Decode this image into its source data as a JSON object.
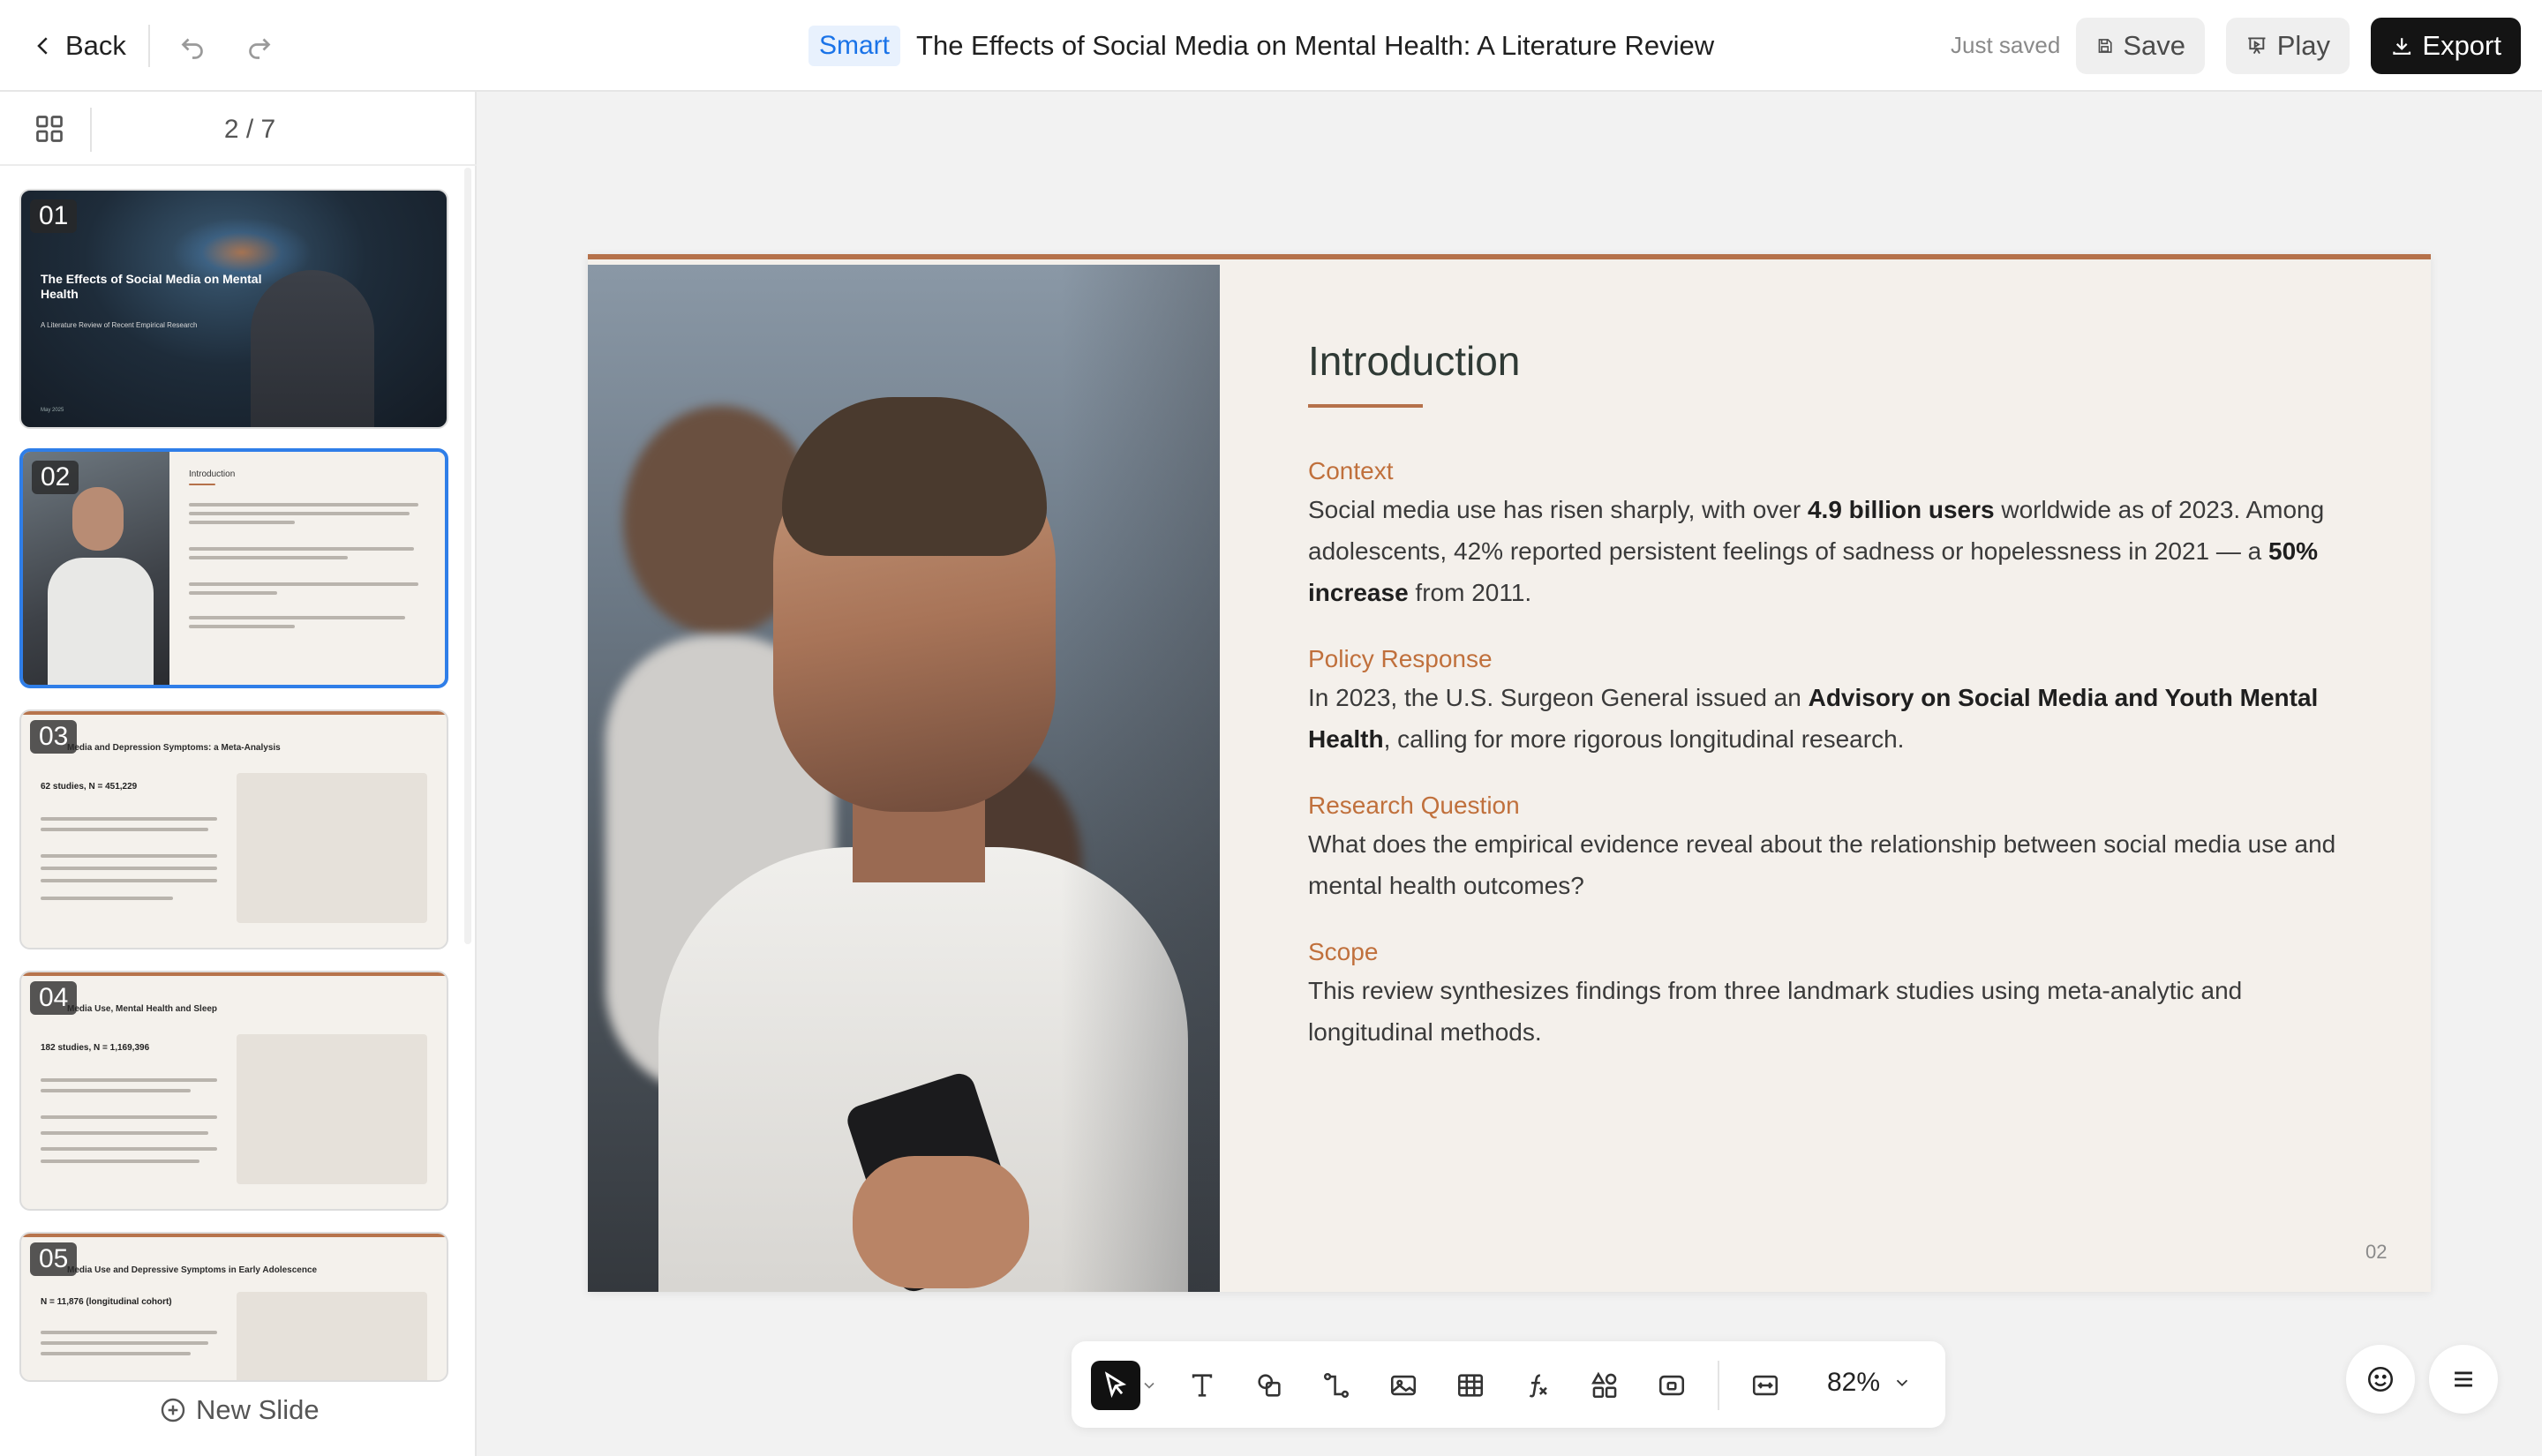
{
  "header": {
    "back_label": "Back",
    "smart_badge": "Smart",
    "doc_title": "The Effects of Social Media on Mental Health: A Literature Review",
    "save_status": "Just saved",
    "save_label": "Save",
    "play_label": "Play",
    "export_label": "Export"
  },
  "sidebar": {
    "slide_counter": "2 / 7",
    "new_slide_label": "New Slide",
    "thumbnails": [
      {
        "num": "01",
        "title": "The Effects of Social Media on Mental Health",
        "subtitle": "A Literature Review of Recent Empirical Research",
        "date": "May 2025"
      },
      {
        "num": "02",
        "title": "Introduction"
      },
      {
        "num": "03",
        "title": "Media and Depression Symptoms: a Meta-Analysis",
        "stat": "62 studies, N = 451,229"
      },
      {
        "num": "04",
        "title": "Media Use, Mental Health and Sleep",
        "stat": "182 studies, N = 1,169,396"
      },
      {
        "num": "05",
        "title": "Media Use and Depressive Symptoms in Early Adolescence",
        "stat": "N = 11,876 (longitudinal cohort)"
      }
    ]
  },
  "slide": {
    "title": "Introduction",
    "sections": [
      {
        "heading": "Context",
        "t1": "Social media use has risen sharply, with over ",
        "b1": "4.9 billion users",
        "t2": " worldwide as of 2023. Among adolescents, 42% reported persistent feelings of sadness or hopelessness in 2021 — a ",
        "b2": "50% increase",
        "t3": " from 2011."
      },
      {
        "heading": "Policy Response",
        "t1": "In 2023, the U.S. Surgeon General issued an ",
        "b1": "Advisory on Social Media and Youth Mental Health",
        "t2": ", calling for more rigorous longitudinal research."
      },
      {
        "heading": "Research Question",
        "t1": "What does the empirical evidence reveal about the relationship between social media use and mental health outcomes?"
      },
      {
        "heading": "Scope",
        "t1": "This review synthesizes findings from three landmark studies using meta-analytic and longitudinal methods."
      }
    ],
    "page_number": "02"
  },
  "toolbar": {
    "tools": [
      "select-icon",
      "text-icon",
      "shape-icon",
      "connector-icon",
      "image-icon",
      "table-icon",
      "formula-icon",
      "components-icon",
      "media-icon",
      "fit-icon"
    ],
    "zoom": "82%"
  },
  "colors": {
    "accent": "#b5714a",
    "section_heading": "#c0703c",
    "selection_blue": "#2f7ee8",
    "export_bg": "#141414"
  }
}
